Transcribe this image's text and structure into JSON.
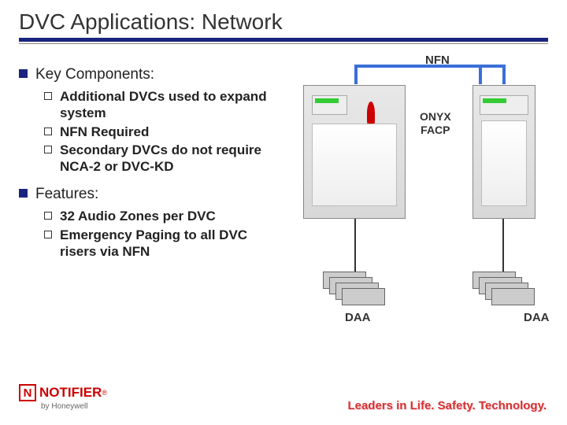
{
  "title": "DVC Applications: Network",
  "sections": [
    {
      "heading": "Key Components:",
      "items": [
        "Additional DVCs used to expand system",
        "NFN Required",
        "Secondary DVCs do not require NCA-2 or DVC-KD"
      ]
    },
    {
      "heading": "Features:",
      "items": [
        "32 Audio Zones per DVC",
        "Emergency Paging to all DVC risers via NFN"
      ]
    }
  ],
  "diagram": {
    "network_label": "NFN",
    "center_label_line1": "ONYX",
    "center_label_line2": "FACP",
    "daa_label_left": "DAA",
    "daa_label_right": "DAA"
  },
  "logo": {
    "mark": "N",
    "name": "NOTIFIER",
    "reg": "®",
    "byline": "by Honeywell"
  },
  "tagline": "Leaders in Life. Safety. Technology."
}
